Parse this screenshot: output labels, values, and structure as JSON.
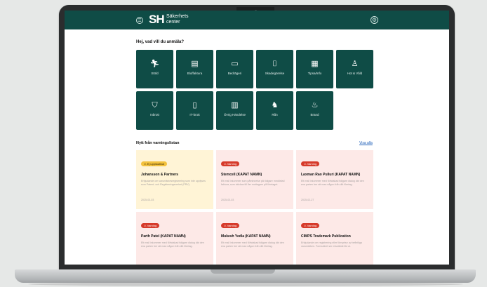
{
  "header": {
    "logo_mark": "SH",
    "logo_line1": "Säkerhets",
    "logo_line2": "center",
    "menu_icon": "hamburger-icon",
    "settings_icon": "gear-icon"
  },
  "main": {
    "question": "Hej, vad vill du anmäla?",
    "categories": [
      {
        "label": "Stöld",
        "icon": "person-running"
      },
      {
        "label": "Bluffaktura",
        "icon": "invoice"
      },
      {
        "label": "Bedrägeri",
        "icon": "card"
      },
      {
        "label": "Skadegörelse",
        "icon": "spray"
      },
      {
        "label": "Tipsa/Info",
        "icon": "store"
      },
      {
        "label": "Hot & Våld",
        "icon": "person-threat"
      },
      {
        "label": "Inbrott",
        "icon": "burglar"
      },
      {
        "label": "IT-brott",
        "icon": "device"
      },
      {
        "label": "Övrig Händelse",
        "icon": "building"
      },
      {
        "label": "Rån",
        "icon": "robbery"
      },
      {
        "label": "Brand",
        "icon": "flame"
      }
    ],
    "warnings": {
      "title": "Nytt från varningslistan",
      "view_all": "Visa alla",
      "cards": [
        {
          "badge": "Ej uppskattad",
          "badge_color": "yellow",
          "title": "Johansson & Partners",
          "desc": "Erbjudande om varumärkesregistrering som inte upplyses som Patent- och Registreringsverket (PRV).",
          "date": "2025-03-03"
        },
        {
          "badge": "Varning",
          "badge_color": "red",
          "title": "Stemcell (KAPAT NAMN)",
          "desc": "Ett mail inkommer som påminnelse på tidigare meddelad faktura, som skickas till fler mottagare på företaget.",
          "date": "2025-03-03"
        },
        {
          "badge": "Varning",
          "badge_color": "red",
          "title": "Laxman Rao Pulluri (KAPAT NAMN)",
          "desc": "Ett mail inkommer med förfalskad tidigare dialog där den ena parten ber att man någon från ditt företag.",
          "date": "2025-02-27"
        },
        {
          "badge": "Varning",
          "badge_color": "red",
          "title": "Parth Patel (KAPAT NAMN)",
          "desc": "Ett mail inkommer med förfalskad tidigare dialog där den ena parten ber att man någon från ditt företag.",
          "date": ""
        },
        {
          "badge": "Varning",
          "badge_color": "red",
          "title": "Mukesh Yedla (KAPAT NAMN)",
          "desc": "Ett mail inkommer med förfalskad tidigare dialog där den ena parten ber att man någon från ditt företag.",
          "date": ""
        },
        {
          "badge": "Varning",
          "badge_color": "red",
          "title": "CIMPS Trademark Publication",
          "desc": "Erbjudande om registrering eller förnyelse av befintliga varumärken. Formuläret ser misstänkt likt ut.",
          "date": ""
        }
      ]
    }
  },
  "colors": {
    "brand": "#0f4c46",
    "warning_red": "#d63a2a",
    "notice_yellow": "#f3c23e",
    "card_pink": "#fde9e7",
    "card_yellow": "#fff4d6",
    "link": "#1f5fb8"
  }
}
